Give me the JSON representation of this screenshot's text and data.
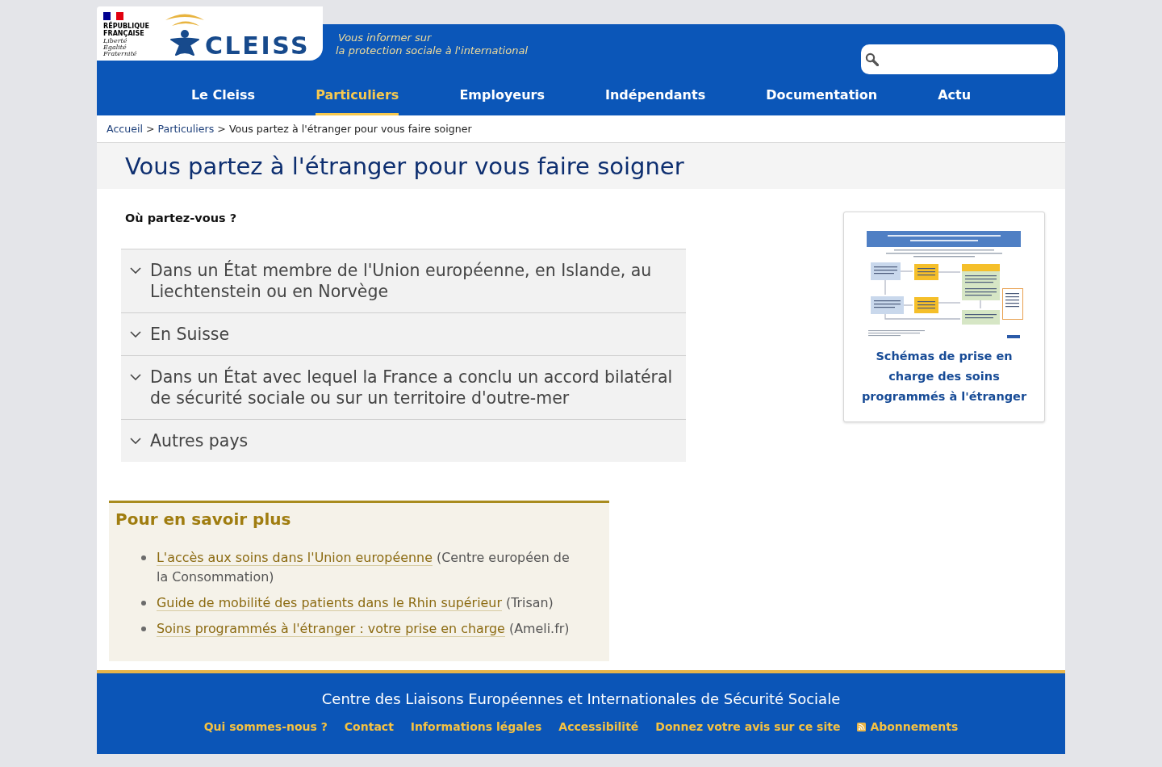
{
  "header": {
    "government_logo": {
      "name_lines": [
        "RÉPUBLIQUE",
        "FRANÇAISE"
      ],
      "motto_lines": [
        "Liberté",
        "Égalité",
        "Fraternité"
      ]
    },
    "logo_text": "CLEISS",
    "tagline": [
      "Vous informer sur",
      "la protection sociale à l'international"
    ]
  },
  "nav": [
    {
      "label": "Le Cleiss",
      "selected": false
    },
    {
      "label": "Particuliers",
      "selected": true
    },
    {
      "label": "Employeurs",
      "selected": false
    },
    {
      "label": "Indépendants",
      "selected": false
    },
    {
      "label": "Documentation",
      "selected": false
    },
    {
      "label": "Actu",
      "selected": false
    }
  ],
  "breadcrumb": [
    {
      "label": "Accueil",
      "kind": "link"
    },
    {
      "label": ">",
      "kind": "separator"
    },
    {
      "label": "Particuliers",
      "kind": "link"
    },
    {
      "label": ">",
      "kind": "separator"
    },
    {
      "label": "Vous partez à l'étranger pour vous faire soigner",
      "kind": "current"
    }
  ],
  "page_title": "Vous partez à l'étranger pour vous faire soigner",
  "question": "Où partez-vous ?",
  "accordion": [
    {
      "label": "Dans un État membre de l'Union européenne, en Islande, au Liechtenstein ou en Norvège",
      "expanded": false
    },
    {
      "label": "En Suisse",
      "expanded": false
    },
    {
      "label": "Dans un État avec lequel la France a conclu un accord bilatéral de sécurité sociale ou sur un territoire d'outre-mer",
      "expanded": false
    },
    {
      "label": "Autres pays",
      "expanded": false
    }
  ],
  "more_info": {
    "title": "Pour en savoir plus",
    "items": [
      {
        "link": "L'accès aux soins dans l'Union européenne",
        "source": "(Centre européen de la Consommation)"
      },
      {
        "link": "Guide de mobilité des patients dans le Rhin supérieur",
        "source": "(Trisan)"
      },
      {
        "link": "Soins programmés à l'étranger : votre prise en charge",
        "source": "(Ameli.fr)"
      }
    ]
  },
  "sidebar_card": {
    "title": "Schémas de prise en charge des soins programmés à l'étranger"
  },
  "footer": {
    "title": "Centre des Liaisons Européennes et Internationales de Sécurité Sociale",
    "links": [
      {
        "label": "Qui sommes-nous ?",
        "kind": "link"
      },
      {
        "label": "Contact",
        "kind": "link"
      },
      {
        "label": "Informations légales",
        "kind": "link"
      },
      {
        "label": "Accessibilité",
        "kind": "link"
      },
      {
        "label": "Donnez votre avis sur ce site",
        "kind": "link"
      },
      {
        "label": "Abonnements",
        "kind": "feed"
      }
    ]
  }
}
